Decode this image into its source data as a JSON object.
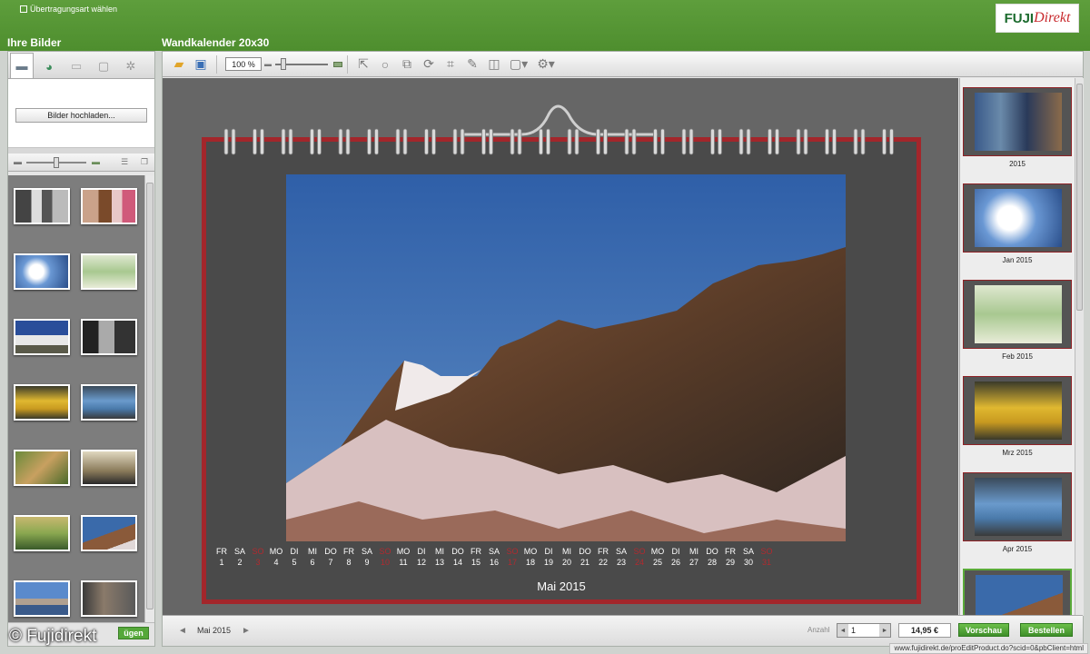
{
  "header": {
    "transfer_link": "Übertragungsart wählen",
    "left_title": "Ihre Bilder",
    "main_title": "Wandkalender 20x30"
  },
  "logo": {
    "part1": "FUJI",
    "part2": "Direkt"
  },
  "left_panel": {
    "upload_button": "Bilder hochladen...",
    "add_button": "ügen"
  },
  "toolbar": {
    "zoom_value": "100 %"
  },
  "calendar": {
    "month_label": "Mai 2015",
    "days": [
      {
        "wd": "FR",
        "d": "1"
      },
      {
        "wd": "SA",
        "d": "2"
      },
      {
        "wd": "SO",
        "d": "3"
      },
      {
        "wd": "MO",
        "d": "4"
      },
      {
        "wd": "DI",
        "d": "5"
      },
      {
        "wd": "MI",
        "d": "6"
      },
      {
        "wd": "DO",
        "d": "7"
      },
      {
        "wd": "FR",
        "d": "8"
      },
      {
        "wd": "SA",
        "d": "9"
      },
      {
        "wd": "SO",
        "d": "10"
      },
      {
        "wd": "MO",
        "d": "11"
      },
      {
        "wd": "DI",
        "d": "12"
      },
      {
        "wd": "MI",
        "d": "13"
      },
      {
        "wd": "DO",
        "d": "14"
      },
      {
        "wd": "FR",
        "d": "15"
      },
      {
        "wd": "SA",
        "d": "16"
      },
      {
        "wd": "SO",
        "d": "17"
      },
      {
        "wd": "MO",
        "d": "18"
      },
      {
        "wd": "DI",
        "d": "19"
      },
      {
        "wd": "MI",
        "d": "20"
      },
      {
        "wd": "DO",
        "d": "21"
      },
      {
        "wd": "FR",
        "d": "22"
      },
      {
        "wd": "SA",
        "d": "23"
      },
      {
        "wd": "SO",
        "d": "24"
      },
      {
        "wd": "MO",
        "d": "25"
      },
      {
        "wd": "DI",
        "d": "26"
      },
      {
        "wd": "MI",
        "d": "27"
      },
      {
        "wd": "DO",
        "d": "28"
      },
      {
        "wd": "FR",
        "d": "29"
      },
      {
        "wd": "SA",
        "d": "30"
      },
      {
        "wd": "SO",
        "d": "31"
      }
    ]
  },
  "pages": [
    {
      "label": "2015"
    },
    {
      "label": "Jan 2015"
    },
    {
      "label": "Feb 2015"
    },
    {
      "label": "Mrz 2015"
    },
    {
      "label": "Apr 2015"
    },
    {
      "label": ""
    }
  ],
  "bottom": {
    "month_nav": "Mai 2015",
    "qty_label": "Anzahl",
    "qty_value": "1",
    "price": "14,95 €",
    "preview_button": "Vorschau",
    "order_button": "Bestellen"
  },
  "status_url": "www.fujidirekt.de/proEditProduct.do?scid=0&pbClient=html",
  "watermark": "© Fujidirekt",
  "colors": {
    "brand_green": "#4e8e2e",
    "calendar_red": "#a3262b",
    "sunday_red": "#b22a2f"
  }
}
